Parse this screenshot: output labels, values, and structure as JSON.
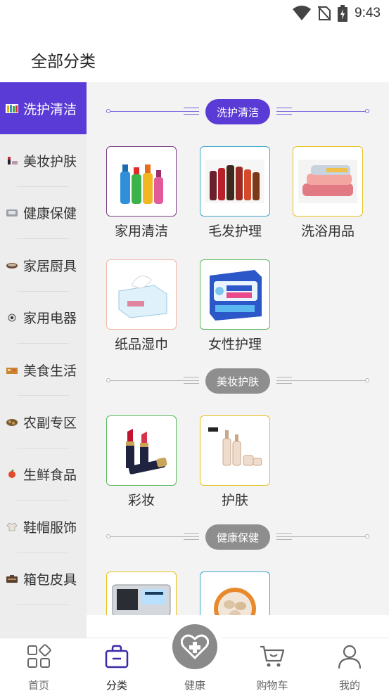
{
  "status_bar": {
    "time": "9:43",
    "icons": [
      "wifi-icon",
      "no-sim-icon",
      "battery-charging-icon"
    ]
  },
  "header": {
    "title": "全部分类"
  },
  "sidebar": {
    "items": [
      {
        "label": "洗护清洁",
        "icon": "laundry-icon",
        "active": true
      },
      {
        "label": "美妆护肤",
        "icon": "lipstick-icon",
        "active": false
      },
      {
        "label": "健康保健",
        "icon": "health-device-icon",
        "active": false
      },
      {
        "label": "家居厨具",
        "icon": "cookware-icon",
        "active": false
      },
      {
        "label": "家用电器",
        "icon": "appliance-icon",
        "active": false
      },
      {
        "label": "美食生活",
        "icon": "food-icon",
        "active": false
      },
      {
        "label": "农副专区",
        "icon": "farm-produce-icon",
        "active": false
      },
      {
        "label": "生鲜食品",
        "icon": "fresh-food-icon",
        "active": false
      },
      {
        "label": "鞋帽服饰",
        "icon": "clothing-icon",
        "active": false
      },
      {
        "label": "箱包皮具",
        "icon": "luggage-icon",
        "active": false
      }
    ]
  },
  "sections": [
    {
      "title": "洗护清洁",
      "style": "purple",
      "items": [
        {
          "label": "家用清洁",
          "image": "cleaning-bottles-image",
          "border": "#7b3f86"
        },
        {
          "label": "毛发护理",
          "image": "shampoo-bottles-image",
          "border": "#3ba7c9"
        },
        {
          "label": "洗浴用品",
          "image": "towels-image",
          "border": "#e7c11e"
        },
        {
          "label": "纸品湿巾",
          "image": "tissue-box-image",
          "border": "#f0b8a8"
        },
        {
          "label": "女性护理",
          "image": "sanitary-pads-image",
          "border": "#5cb85c"
        }
      ]
    },
    {
      "title": "美妆护肤",
      "style": "gray",
      "items": [
        {
          "label": "彩妆",
          "image": "lipstick-image",
          "border": "#5cb85c"
        },
        {
          "label": "护肤",
          "image": "skincare-bottles-image",
          "border": "#e7c11e"
        }
      ]
    },
    {
      "title": "健康保健",
      "style": "gray",
      "items": [
        {
          "label": "",
          "image": "blood-pressure-monitor-image",
          "border": "#e7c11e"
        },
        {
          "label": "",
          "image": "supplement-plate-image",
          "border": "#3ba7c9"
        }
      ]
    }
  ],
  "bottom_nav": {
    "items": [
      {
        "label": "首页",
        "icon": "home-grid-icon",
        "active": false
      },
      {
        "label": "分类",
        "icon": "category-bag-icon",
        "active": true
      },
      {
        "label": "健康",
        "icon": "health-heart-cross-icon",
        "active": false
      },
      {
        "label": "购物车",
        "icon": "shopping-cart-icon",
        "active": false
      },
      {
        "label": "我的",
        "icon": "user-icon",
        "active": false
      }
    ]
  },
  "colors": {
    "accent": "#5b3bd6",
    "sidebar_bg": "#ededed",
    "content_bg": "#f3f3f3",
    "pill_gray": "#8e8e8e"
  }
}
